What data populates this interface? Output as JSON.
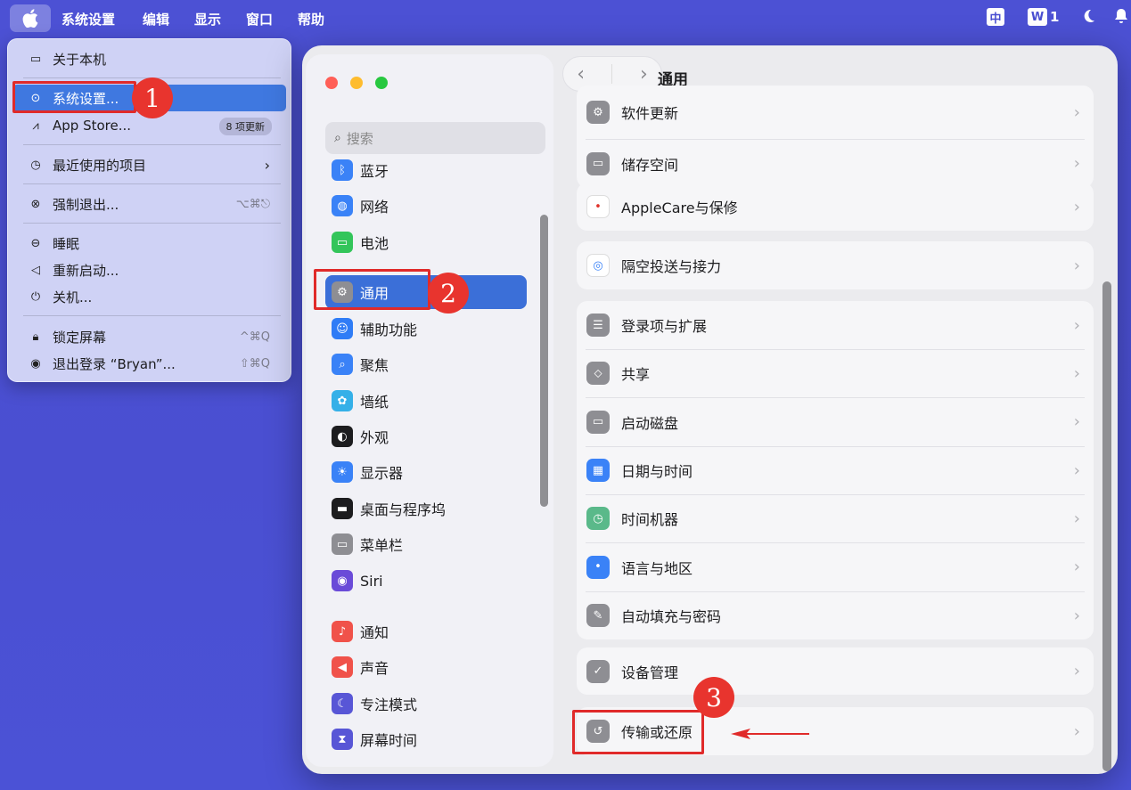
{
  "menubar": {
    "apple": "",
    "app_name": "系统设置",
    "items": [
      "编辑",
      "显示",
      "窗口",
      "帮助"
    ],
    "ime": "中",
    "wps_count": "1"
  },
  "apple_menu": {
    "about": "关于本机",
    "system_settings": "系统设置...",
    "app_store": "App Store...",
    "app_store_badge": "8 项更新",
    "recent_items": "最近使用的项目",
    "force_quit": "强制退出...",
    "force_quit_shortcut": "⌥⌘⎋",
    "sleep": "睡眠",
    "restart": "重新启动...",
    "shutdown": "关机...",
    "lock_screen": "锁定屏幕",
    "lock_shortcut": "^⌘Q",
    "logout": "退出登录 “Bryan”...",
    "logout_shortcut": "⇧⌘Q"
  },
  "annotations": {
    "step1": "1",
    "step2": "2",
    "step3": "3"
  },
  "sidebar": {
    "search_placeholder": "搜索",
    "items": [
      {
        "label": "蓝牙",
        "icon": "bluetooth-icon",
        "color": "#3a82f7"
      },
      {
        "label": "网络",
        "icon": "globe-icon",
        "color": "#3a82f7"
      },
      {
        "label": "电池",
        "icon": "battery-icon",
        "color": "#33c55a"
      },
      {
        "label": "通用",
        "icon": "gear-icon",
        "color": "#8e8e93"
      },
      {
        "label": "辅助功能",
        "icon": "accessibility-icon",
        "color": "#2f7cf6"
      },
      {
        "label": "聚焦",
        "icon": "magnifier-icon",
        "color": "#3a82f7"
      },
      {
        "label": "墙纸",
        "icon": "flower-icon",
        "color": "#35b0e8"
      },
      {
        "label": "外观",
        "icon": "appearance-icon",
        "color": "#1d1d1f"
      },
      {
        "label": "显示器",
        "icon": "sun-icon",
        "color": "#3a82f7"
      },
      {
        "label": "桌面与程序坞",
        "icon": "dock-icon",
        "color": "#1d1d1f"
      },
      {
        "label": "菜单栏",
        "icon": "menubar-icon",
        "color": "#8e8e93"
      },
      {
        "label": "Siri",
        "icon": "siri-icon",
        "color": "#6a4bd8"
      },
      {
        "label": "通知",
        "icon": "bell-icon",
        "color": "#f0524a"
      },
      {
        "label": "声音",
        "icon": "speaker-icon",
        "color": "#f0524a"
      },
      {
        "label": "专注模式",
        "icon": "moon-icon",
        "color": "#5856d6"
      },
      {
        "label": "屏幕时间",
        "icon": "hourglass-icon",
        "color": "#5856d6"
      }
    ]
  },
  "main": {
    "title": "通用",
    "back": "‹",
    "forward": "›",
    "groups": [
      {
        "rows": [
          {
            "label": "软件更新",
            "icon": "gear-badge-icon",
            "color": "#8e8e93"
          },
          {
            "label": "储存空间",
            "icon": "drive-icon",
            "color": "#8e8e93"
          }
        ]
      },
      {
        "rows": [
          {
            "label": "AppleCare与保修",
            "icon": "apple-red-icon",
            "color": "#ffffff"
          }
        ]
      },
      {
        "rows": [
          {
            "label": "隔空投送与接力",
            "icon": "airdrop-icon",
            "color": "#ffffff"
          }
        ]
      },
      {
        "rows": [
          {
            "label": "登录项与扩展",
            "icon": "list-icon",
            "color": "#8e8e93"
          },
          {
            "label": "共享",
            "icon": "share-icon",
            "color": "#8e8e93"
          },
          {
            "label": "启动磁盘",
            "icon": "disk-icon",
            "color": "#8e8e93"
          },
          {
            "label": "日期与时间",
            "icon": "calendar-icon",
            "color": "#3a82f7"
          },
          {
            "label": "时间机器",
            "icon": "time-machine-icon",
            "color": "#5ab98a"
          },
          {
            "label": "语言与地区",
            "icon": "globe-icon",
            "color": "#3a82f7"
          },
          {
            "label": "自动填充与密码",
            "icon": "autofill-icon",
            "color": "#8e8e93"
          }
        ]
      },
      {
        "rows": [
          {
            "label": "设备管理",
            "icon": "check-badge-icon",
            "color": "#8e8e93"
          }
        ]
      },
      {
        "rows": [
          {
            "label": "传输或还原",
            "icon": "restore-icon",
            "color": "#8e8e93"
          }
        ]
      }
    ]
  }
}
